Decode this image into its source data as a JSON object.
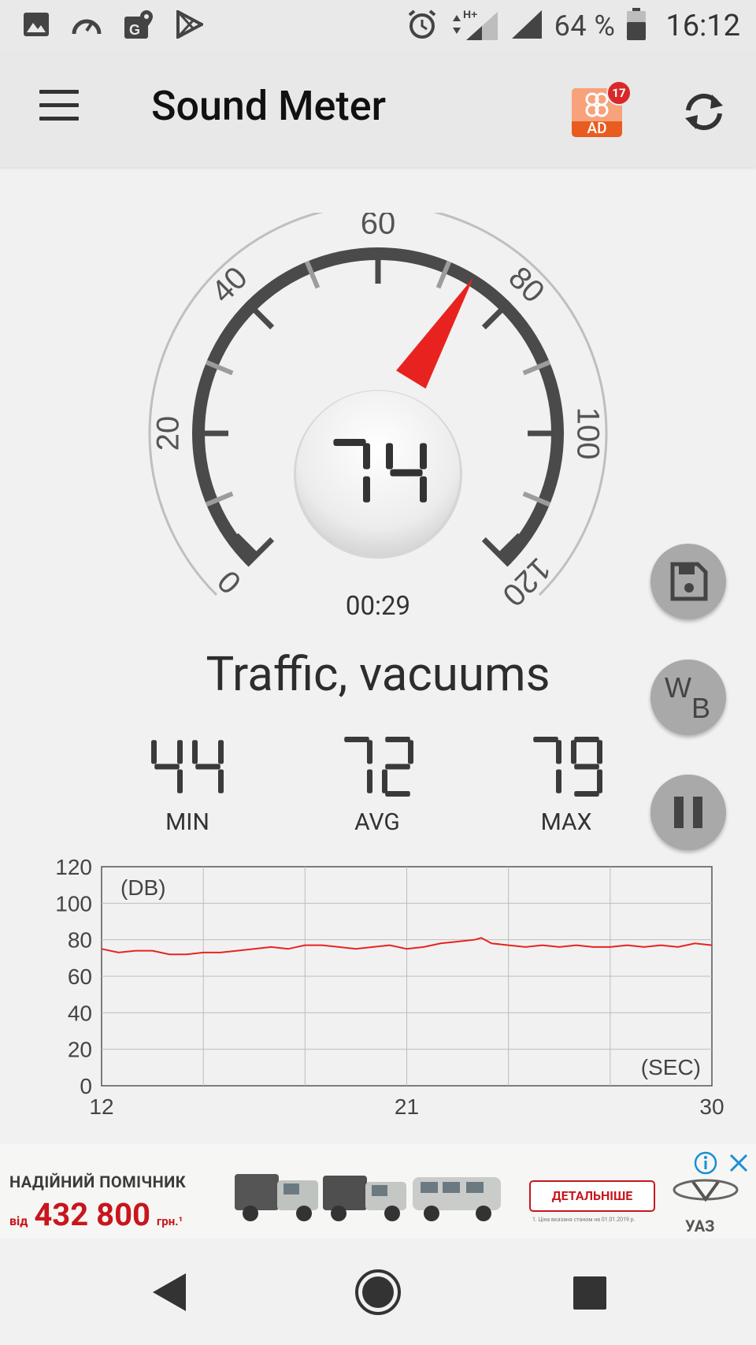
{
  "status_bar": {
    "icons": [
      "gallery-icon",
      "speedometer-icon",
      "maps-icon",
      "play-store-icon",
      "alarm-icon",
      "data-arrows-icon",
      "signal-icon",
      "signal-icon",
      "battery-icon"
    ],
    "network_type": "H+",
    "battery_percent": "64 %",
    "time": "16:12"
  },
  "app_bar": {
    "title": "Sound Meter",
    "ad_label": "AD",
    "ad_badge_count": "17"
  },
  "gauge": {
    "current_value": "74",
    "min_scale": 0,
    "max_scale": 120,
    "tick_labels": [
      "0",
      "20",
      "40",
      "60",
      "80",
      "100",
      "120"
    ],
    "elapsed_time": "00:29"
  },
  "category": "Traffic, vacuums",
  "stats": {
    "min": {
      "value": "44",
      "label": "MIN"
    },
    "avg": {
      "value": "72",
      "label": "AVG"
    },
    "max": {
      "value": "79",
      "label": "MAX"
    }
  },
  "side_buttons": {
    "save": "save-icon",
    "weighting_label_top": "W",
    "weighting_label_bottom": "B",
    "pause": "pause-icon"
  },
  "chart_data": {
    "type": "line",
    "ylabel": "(DB)",
    "xlabel": "(SEC)",
    "ylim": [
      0,
      120
    ],
    "y_ticks": [
      "0",
      "20",
      "40",
      "60",
      "80",
      "100",
      "120"
    ],
    "xlim": [
      12,
      30
    ],
    "x_ticks": [
      "12",
      "21",
      "30"
    ],
    "grid": true,
    "line_color": "#e8231f",
    "series": [
      {
        "x": [
          12,
          12.5,
          13,
          13.5,
          14,
          14.5,
          15,
          15.5,
          16,
          16.5,
          17,
          17.5,
          18,
          18.5,
          19,
          19.5,
          20,
          20.5,
          21,
          21.5,
          22,
          22.5,
          23,
          23.2,
          23.5,
          24,
          24.5,
          25,
          25.5,
          26,
          26.5,
          27,
          27.5,
          28,
          28.5,
          29,
          29.5,
          30
        ],
        "y": [
          75,
          73,
          74,
          74,
          72,
          72,
          73,
          73,
          74,
          75,
          76,
          75,
          77,
          77,
          76,
          75,
          76,
          77,
          75,
          76,
          78,
          79,
          80,
          81,
          78,
          77,
          76,
          77,
          76,
          77,
          76,
          76,
          77,
          76,
          77,
          76,
          78,
          77
        ]
      }
    ]
  },
  "ad_banner": {
    "headline": "НАДІЙНИЙ ПОМІЧНИК",
    "price_from": "від",
    "price_value": "432 800",
    "price_currency": "грн.¹",
    "cta": "ДЕТАЛЬНІШЕ",
    "footnote": "1. Ціна вказана станом на 01.01.2019 р.",
    "brand": "УАЗ"
  },
  "colors": {
    "accent_red": "#e8231f",
    "gauge_dark": "#4a4a4a",
    "fab_gray": "#a9a9a9"
  }
}
